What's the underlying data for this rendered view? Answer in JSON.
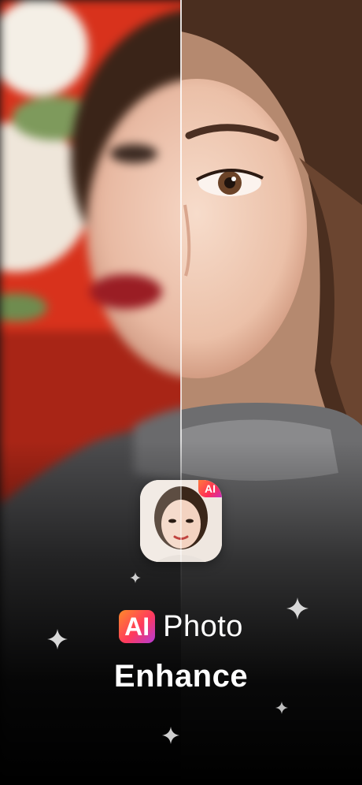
{
  "app_icon": {
    "name": "app-icon",
    "badge_text": "AI"
  },
  "title": {
    "ai_label": "AI",
    "line1": "Photo",
    "line2": "Enhance"
  },
  "colors": {
    "badge_gradient_start": "#ff8a2a",
    "badge_gradient_mid": "#ff3a5c",
    "badge_gradient_end": "#b43bd9",
    "background_red": "#d8321c",
    "text": "#ffffff"
  },
  "icons": [
    "comparison-divider",
    "sparkle-icon"
  ]
}
